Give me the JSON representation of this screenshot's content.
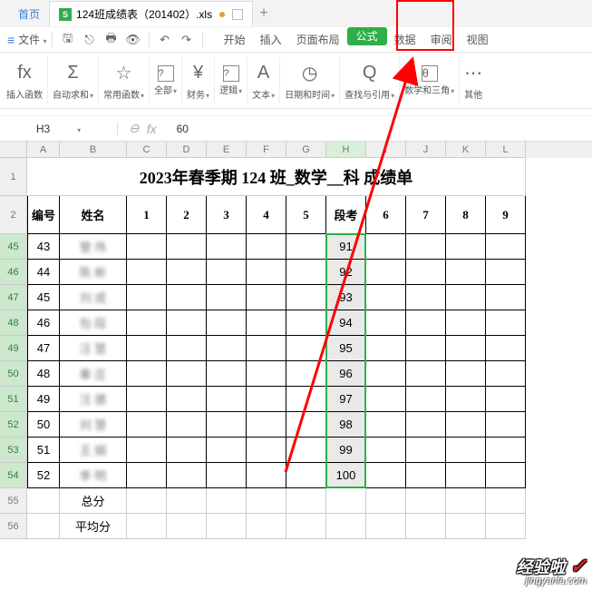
{
  "tabs": {
    "home": "首页",
    "file": "124班成绩表（201402）.xls",
    "plus": "+"
  },
  "menu": {
    "file_label": "文件",
    "items": [
      "开始",
      "插入",
      "页面布局",
      "公式",
      "数据",
      "审阅",
      "视图"
    ],
    "active": "公式"
  },
  "ribbon": {
    "insert_fn": "插入函数",
    "auto_sum": "自动求和",
    "common_fn": "常用函数",
    "all": "全部",
    "finance": "财务",
    "logic": "逻辑",
    "text": "文本",
    "datetime": "日期和时间",
    "lookup": "查找与引用",
    "math": "数学和三角",
    "other": "其他",
    "fx": "fx",
    "sigma": "Σ",
    "star": "☆",
    "boxq": "?",
    "yen": "¥",
    "qbox": "?",
    "A": "A",
    "clock": "◷",
    "Q": "Q",
    "theta": "θ"
  },
  "fxbar": {
    "cell": "H3",
    "fx": "fx",
    "value": "60",
    "zoom": "⊖"
  },
  "cols": [
    "A",
    "B",
    "C",
    "D",
    "E",
    "F",
    "G",
    "H",
    "I",
    "J",
    "K",
    "L"
  ],
  "title": "2023年春季期 124 班_数学__科 成绩单",
  "headers": {
    "r": "2",
    "A": "编号",
    "B": "姓名",
    "C": "1",
    "D": "2",
    "E": "3",
    "F": "4",
    "G": "5",
    "H": "段考",
    "I": "6",
    "J": "7",
    "K": "8",
    "L": "9"
  },
  "data_rows": [
    {
      "r": "45",
      "A": "43",
      "B": "管    伟",
      "H": "91"
    },
    {
      "r": "46",
      "A": "44",
      "B": "陈    彬",
      "H": "92"
    },
    {
      "r": "47",
      "A": "45",
      "B": "刘    成",
      "H": "93"
    },
    {
      "r": "48",
      "A": "46",
      "B": "包    段",
      "H": "94"
    },
    {
      "r": "49",
      "A": "47",
      "B": "汪    慧",
      "H": "95"
    },
    {
      "r": "50",
      "A": "48",
      "B": "秦    庄",
      "H": "96"
    },
    {
      "r": "51",
      "A": "49",
      "B": "汪    德",
      "H": "97"
    },
    {
      "r": "52",
      "A": "50",
      "B": "刘    慧",
      "H": "98"
    },
    {
      "r": "53",
      "A": "51",
      "B": "王    娟",
      "H": "99"
    },
    {
      "r": "54",
      "A": "52",
      "B": "李    明",
      "H": "100"
    }
  ],
  "footer_rows": [
    {
      "r": "55",
      "B": "总分"
    },
    {
      "r": "56",
      "B": "平均分"
    }
  ],
  "title_row": "1",
  "colw": {
    "A": 36,
    "B": 74,
    "C": 44,
    "D": 44,
    "E": 44,
    "F": 44,
    "G": 44,
    "H": 44,
    "I": 44,
    "J": 44,
    "K": 44,
    "L": 44
  },
  "watermark": {
    "line1": "经验啦",
    "check": "✓",
    "line2": "jingyanla.com"
  }
}
